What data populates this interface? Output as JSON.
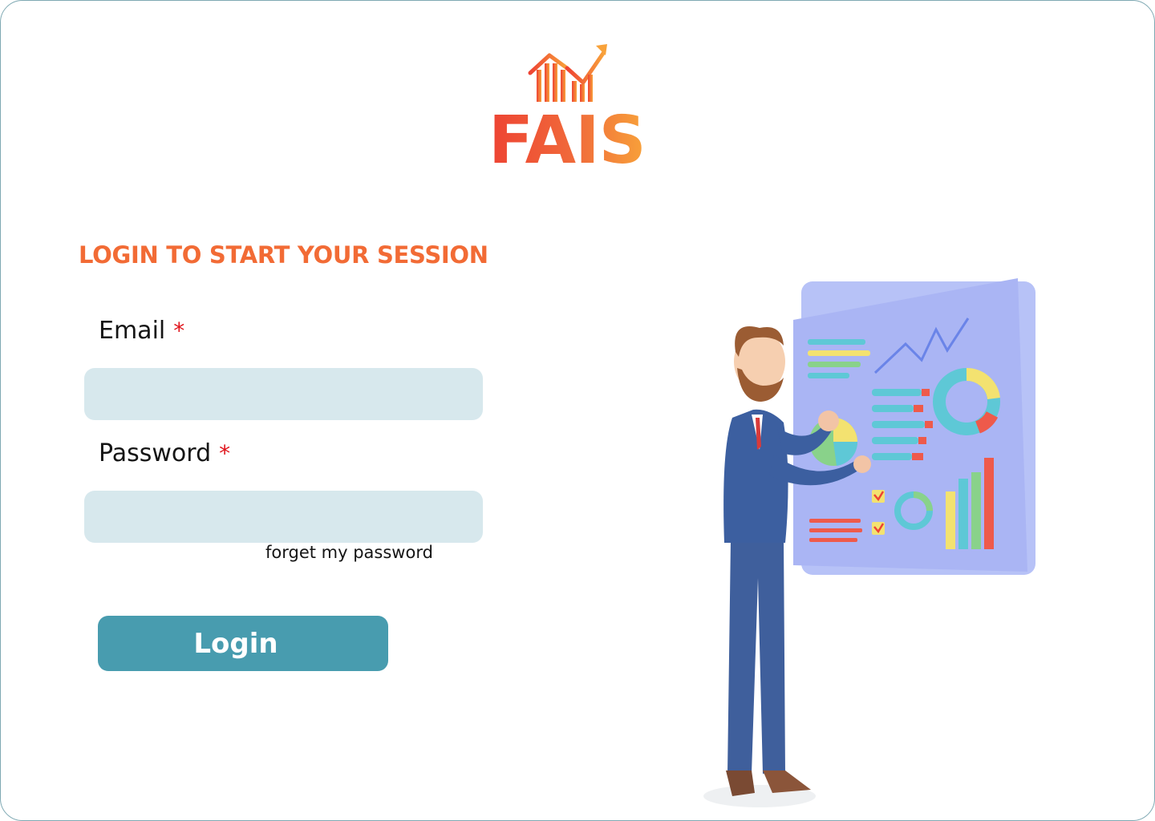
{
  "brand": {
    "name": "FAIS",
    "logo_icon": "chart-growth-icon",
    "gradient": [
      "#ee4333",
      "#f8a23a"
    ]
  },
  "login_form": {
    "heading": "LOGIN TO START YOUR SESSION",
    "email": {
      "label": "Email",
      "required_mark": "*",
      "value": "",
      "placeholder": ""
    },
    "password": {
      "label": "Password",
      "required_mark": "*",
      "value": "",
      "placeholder": ""
    },
    "forgot_link": "forget my password",
    "submit_label": "Login"
  },
  "colors": {
    "accent": "#f26b35",
    "button": "#489caf",
    "input_background": "#d7e8ed",
    "required": "#e0141c"
  },
  "illustration": {
    "subject": "businessman-presenting-dashboard",
    "icon": "analytics-board-icon"
  }
}
